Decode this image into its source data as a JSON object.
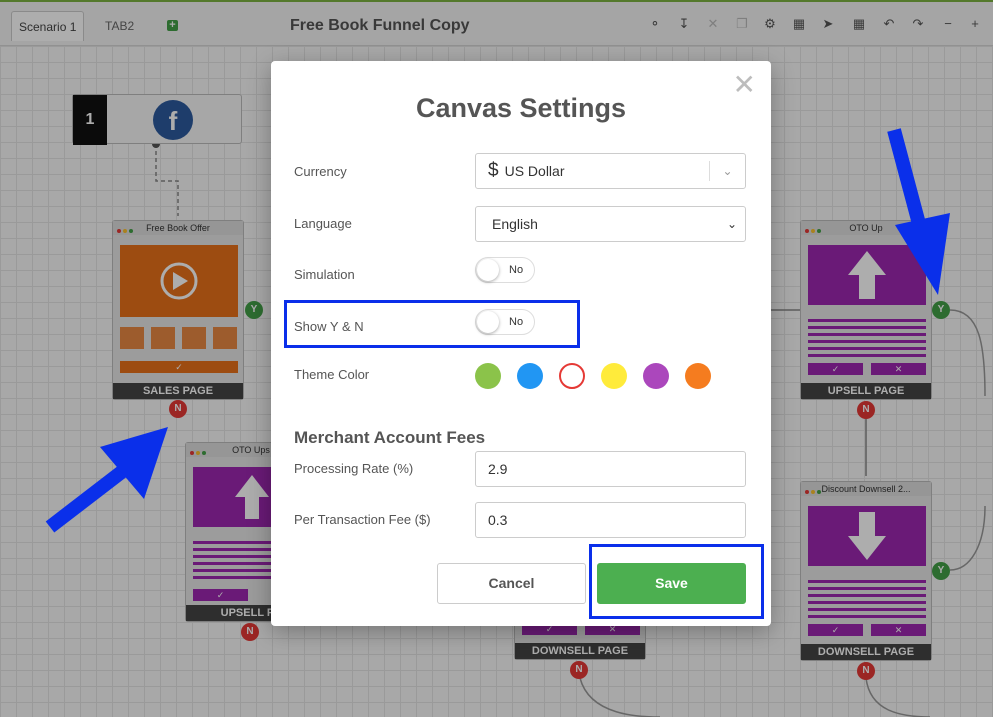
{
  "tabs": {
    "tab1": "Scenario 1",
    "tab2": "TAB2",
    "add": "+"
  },
  "title": "Free Book Funnel Copy",
  "toolbar_icons": [
    "share-icon",
    "download-icon",
    "close-icon",
    "copy-icon",
    "gear-icon",
    "calculator-icon",
    "pointer-icon",
    "grid-icon",
    "undo-icon",
    "redo-icon",
    "minus-icon",
    "plus-icon"
  ],
  "canvas": {
    "start_number": "1",
    "fb_glyph": "f",
    "nodes": {
      "sales": {
        "bar": "Free Book Offer",
        "footer": "SALES PAGE"
      },
      "upsell_left": {
        "bar": "OTO Ups",
        "footer": "UPSELL PA"
      },
      "upsell_right": {
        "bar": "OTO Up",
        "footer": "UPSELL PAGE"
      },
      "downsell_right": {
        "bar": "Discount Downsell 2...",
        "footer": "DOWNSELL PAGE"
      },
      "downsell_mid": {
        "footer": "DOWNSELL PAGE"
      }
    },
    "yes": "Y",
    "no": "N"
  },
  "modal": {
    "title": "Canvas Settings",
    "close": "✕",
    "currency": {
      "label": "Currency",
      "symbol": "$",
      "value": "US Dollar"
    },
    "language": {
      "label": "Language",
      "value": "English"
    },
    "simulation": {
      "label": "Simulation",
      "state": "No"
    },
    "show_yn": {
      "label": "Show Y & N",
      "state": "No"
    },
    "theme": {
      "label": "Theme Color",
      "colors": [
        "#8bc34a",
        "#2196f3",
        "#ffffff",
        "#ffeb3b",
        "#ab47bc",
        "#f57c1f"
      ],
      "selected_ring": "#e53935"
    },
    "merchant": {
      "heading": "Merchant Account Fees",
      "rate_label": "Processing Rate (%)",
      "rate_value": "2.9",
      "fee_label": "Per Transaction Fee ($)",
      "fee_value": "0.3"
    },
    "cancel": "Cancel",
    "save": "Save"
  },
  "colors": {
    "highlight": "#0a2fea",
    "save_green": "#4caf50",
    "node_purple": "#9c27b0",
    "node_orange": "#e8701a"
  }
}
